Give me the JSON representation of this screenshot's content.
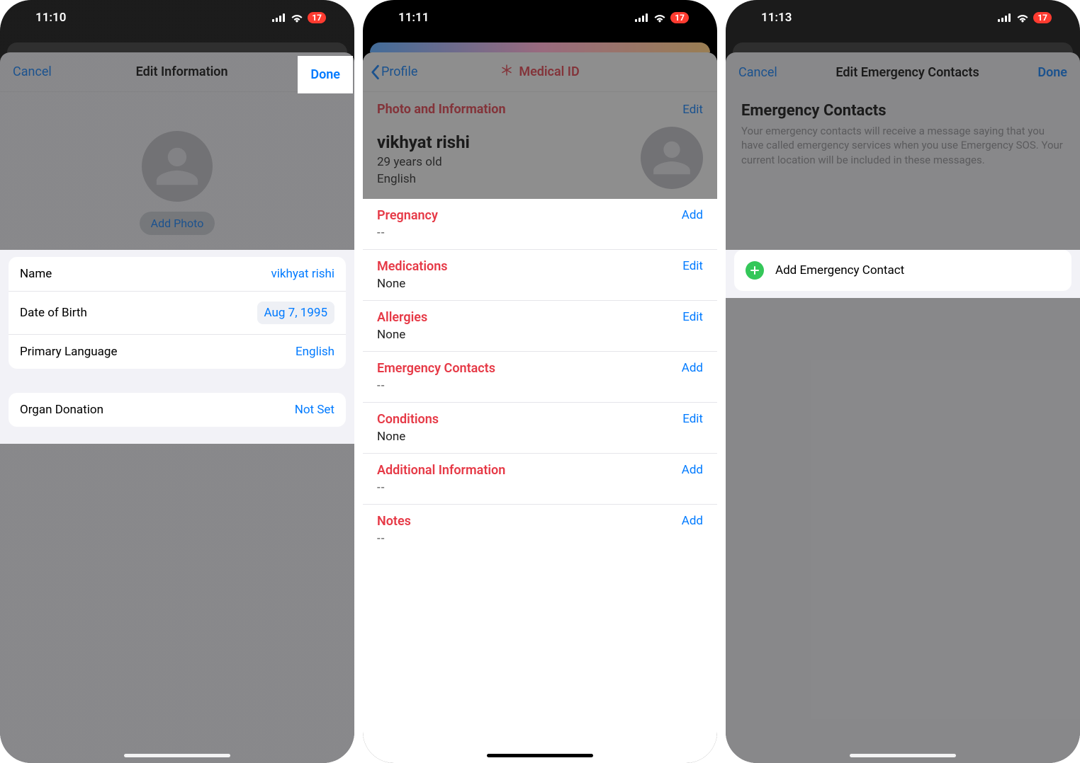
{
  "status_bar": {
    "battery_pct": "17"
  },
  "screen1": {
    "time": "11:10",
    "nav": {
      "cancel": "Cancel",
      "title": "Edit Information",
      "done": "Done"
    },
    "add_photo": "Add Photo",
    "rows": {
      "name_label": "Name",
      "name_value": "vikhyat rishi",
      "dob_label": "Date of Birth",
      "dob_value": "Aug 7, 1995",
      "lang_label": "Primary Language",
      "lang_value": "English",
      "organ_label": "Organ Donation",
      "organ_value": "Not Set"
    }
  },
  "screen2": {
    "time": "11:11",
    "nav": {
      "back": "Profile",
      "title": "Medical ID"
    },
    "info": {
      "section_title": "Photo and Information",
      "edit": "Edit",
      "name": "vikhyat rishi",
      "age": "29 years old",
      "language": "English"
    },
    "records": [
      {
        "title": "Pregnancy",
        "value": "--",
        "action": "Add",
        "dash": true
      },
      {
        "title": "Medications",
        "value": "None",
        "action": "Edit"
      },
      {
        "title": "Allergies",
        "value": "None",
        "action": "Edit"
      },
      {
        "title": "Emergency Contacts",
        "value": "--",
        "action": "Add",
        "dash": true
      },
      {
        "title": "Conditions",
        "value": "None",
        "action": "Edit"
      },
      {
        "title": "Additional Information",
        "value": "--",
        "action": "Add",
        "dash": true
      },
      {
        "title": "Notes",
        "value": "--",
        "action": "Add",
        "dash": true
      }
    ]
  },
  "screen3": {
    "time": "11:13",
    "nav": {
      "cancel": "Cancel",
      "title": "Edit Emergency Contacts",
      "done": "Done"
    },
    "section_title": "Emergency Contacts",
    "section_desc": "Your emergency contacts will receive a message saying that you have called emergency services when you use Emergency SOS. Your current location will be included in these messages.",
    "add_row": "Add Emergency Contact"
  }
}
